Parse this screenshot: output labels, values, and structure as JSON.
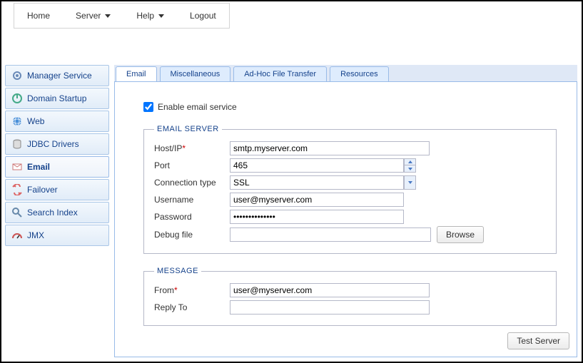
{
  "topmenu": {
    "home": "Home",
    "server": "Server",
    "help": "Help",
    "logout": "Logout"
  },
  "sidebar": {
    "items": [
      {
        "label": "Manager Service",
        "icon": "gear"
      },
      {
        "label": "Domain Startup",
        "icon": "power"
      },
      {
        "label": "Web",
        "icon": "globe"
      },
      {
        "label": "JDBC Drivers",
        "icon": "db"
      },
      {
        "label": "Email",
        "icon": "mail"
      },
      {
        "label": "Failover",
        "icon": "failover"
      },
      {
        "label": "Search Index",
        "icon": "search"
      },
      {
        "label": "JMX",
        "icon": "jmx"
      }
    ],
    "active_index": 4
  },
  "tabs": {
    "items": [
      "Email",
      "Miscellaneous",
      "Ad-Hoc File Transfer",
      "Resources"
    ],
    "active_index": 0
  },
  "form": {
    "enable_label": "Enable email service",
    "enable_checked": true,
    "fieldset_server": "EMAIL SERVER",
    "fieldset_message": "MESSAGE",
    "labels": {
      "host": "Host/IP",
      "port": "Port",
      "conn": "Connection type",
      "user": "Username",
      "pass": "Password",
      "debug": "Debug file",
      "from": "From",
      "reply": "Reply To"
    },
    "values": {
      "host": "smtp.myserver.com",
      "port": "465",
      "conn": "SSL",
      "user": "user@myserver.com",
      "pass": "••••••••••••••",
      "debug": "",
      "from": "user@myserver.com",
      "reply": ""
    },
    "required_mark": "*",
    "browse_btn": "Browse",
    "test_btn": "Test Server"
  }
}
